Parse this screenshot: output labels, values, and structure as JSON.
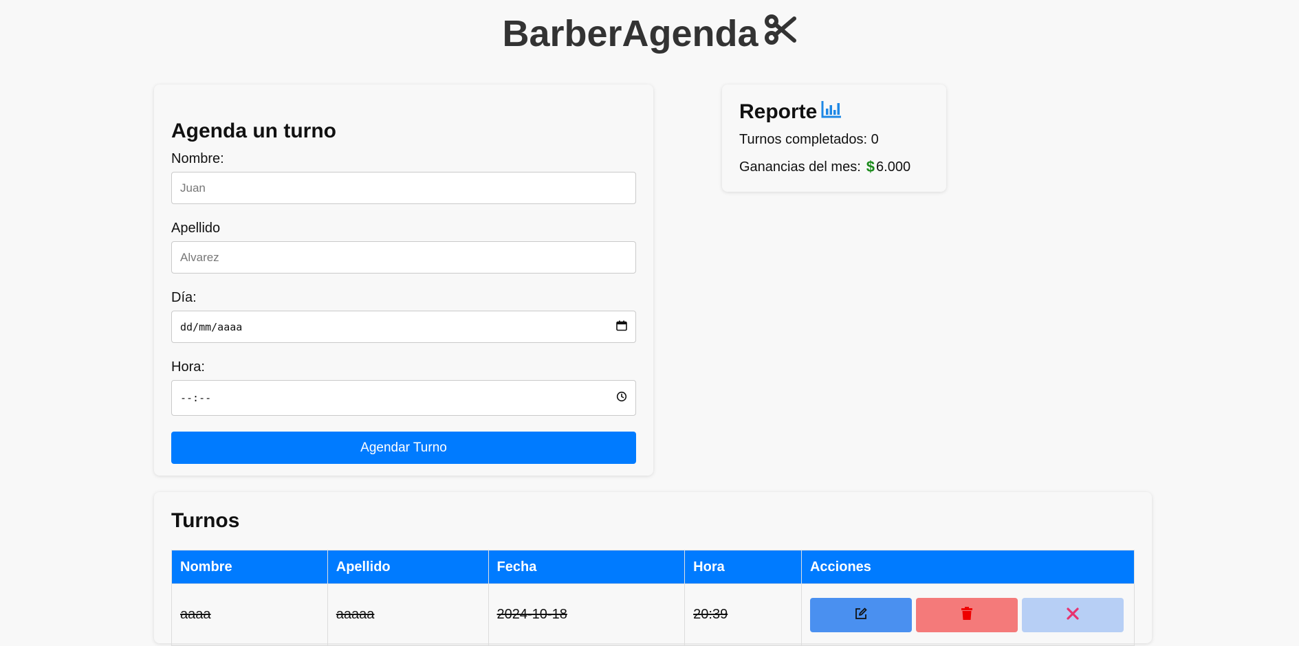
{
  "header": {
    "title": "BarberAgenda"
  },
  "form": {
    "heading": "Agenda un turno",
    "nombre_label": "Nombre:",
    "nombre_placeholder": "Juan",
    "apellido_label": "Apellido",
    "apellido_placeholder": "Alvarez",
    "dia_label": "Día:",
    "dia_value": "dd/mm/aaaa",
    "hora_label": "Hora:",
    "hora_value": "--:--",
    "submit_label": "Agendar Turno"
  },
  "report": {
    "heading": "Reporte",
    "completed_label": "Turnos completados: 0",
    "earnings_label": "Ganancias del mes:",
    "earnings_value": "6.000"
  },
  "turnos": {
    "heading": "Turnos",
    "columns": [
      "Nombre",
      "Apellido",
      "Fecha",
      "Hora",
      "Acciones"
    ],
    "rows": [
      {
        "nombre": "aaaa",
        "apellido": "aaaaa",
        "fecha": "2024-10-18",
        "hora": "20:39"
      }
    ]
  },
  "colors": {
    "primary": "#007bff",
    "money": "#1a8a1a",
    "delete": "#f47a7a",
    "cancel_icon": "#e8336f"
  },
  "icons": {
    "title": "scissors-icon",
    "report": "chart-bar-icon",
    "money": "dollar-icon",
    "date": "calendar-icon",
    "time": "clock-icon",
    "edit": "edit-icon",
    "delete": "trash-icon",
    "cancel": "close-icon"
  }
}
